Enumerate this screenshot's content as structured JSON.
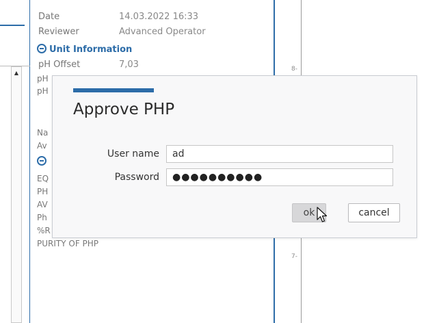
{
  "details": {
    "date_label": "Date",
    "date_value": "14.03.2022 16:33",
    "reviewer_label": "Reviewer",
    "reviewer_value": "Advanced Operator",
    "unit_information_heading": "Unit Information",
    "ph_offset_label": "pH Offset",
    "ph_offset_value": "7,03",
    "cut_labels": [
      "pH",
      "pH",
      "Na",
      "Av",
      "EQ",
      "PH",
      "AV",
      "Ph",
      "%R"
    ],
    "purity_label": "PURITY OF PHP"
  },
  "chart": {
    "tick_top": "8-",
    "tick_bottom": "7-"
  },
  "dialog": {
    "title": "Approve PHP",
    "username_label": "User name",
    "username_value": "ad",
    "password_label": "Password",
    "password_value": "●●●●●●●●●●",
    "ok_label": "ok",
    "cancel_label": "cancel"
  },
  "icons": {
    "collapse": "circle-minus-icon",
    "scroll_up": "arrow-up-icon",
    "cursor": "mouse-pointer-icon"
  },
  "colors": {
    "accent": "#2c6ca8",
    "dialog_bg": "#f8f8f9",
    "ok_button_bg": "#d7d7d9"
  }
}
